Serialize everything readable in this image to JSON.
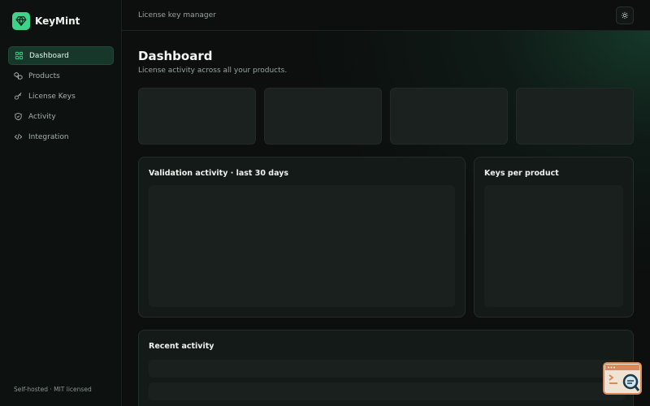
{
  "brand": {
    "name": "KeyMint"
  },
  "nav": {
    "items": [
      {
        "label": "Dashboard",
        "icon": "grid-icon",
        "active": true
      },
      {
        "label": "Products",
        "icon": "boxes-icon"
      },
      {
        "label": "License Keys",
        "icon": "key-icon"
      },
      {
        "label": "Activity",
        "icon": "shield-icon"
      },
      {
        "label": "Integration",
        "icon": "code-icon"
      }
    ]
  },
  "sidebar_footer": "Self-hosted · MIT licensed",
  "topbar": {
    "breadcrumb": "License key manager",
    "theme_toggle_icon": "sun-icon"
  },
  "page": {
    "title": "Dashboard",
    "subtitle": "License activity across all your products."
  },
  "cards": {
    "validation": {
      "title": "Validation activity · last 30 days"
    },
    "keys_per_product": {
      "title": "Keys per product"
    },
    "recent": {
      "title": "Recent activity"
    }
  },
  "colors": {
    "accent": "#3fd38a",
    "background": "#0c0f0e",
    "active_nav": "#17372a"
  }
}
